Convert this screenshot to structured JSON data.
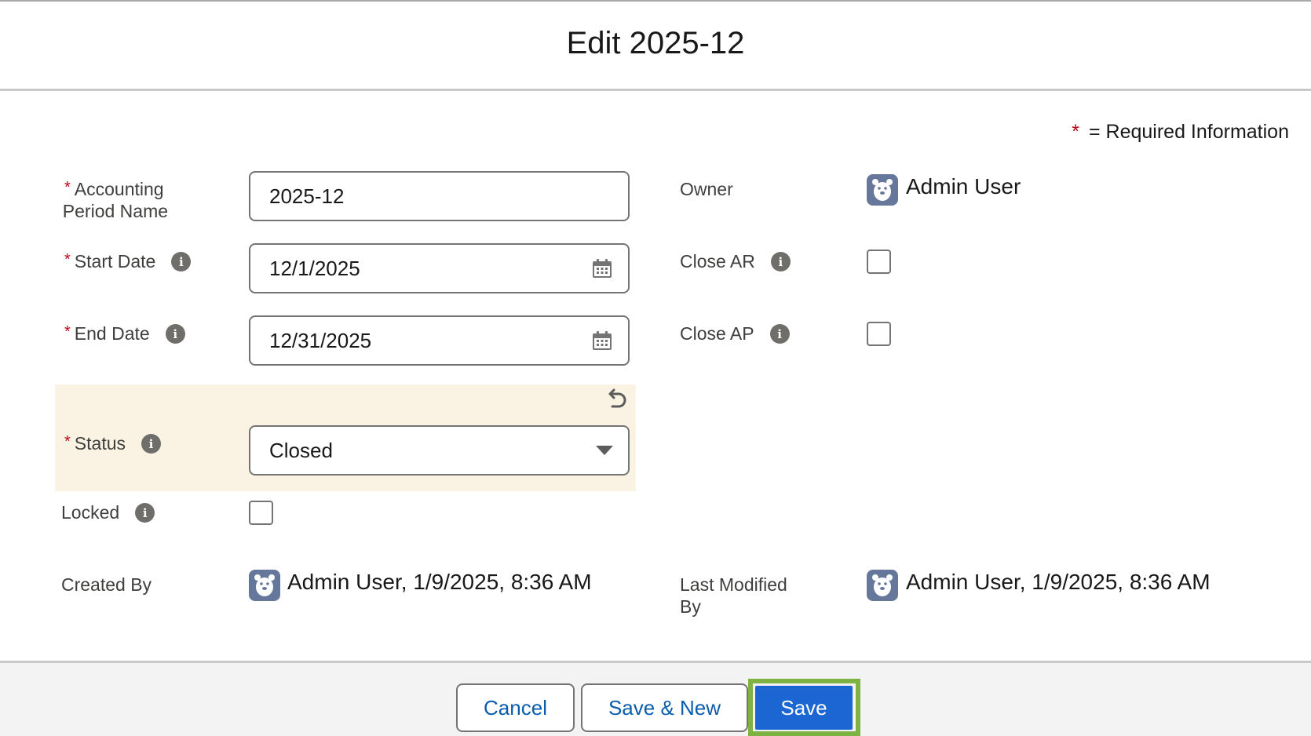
{
  "modal": {
    "title": "Edit 2025-12"
  },
  "required_info": {
    "star": "*",
    "text": "= Required Information"
  },
  "fields": {
    "accounting_period_name": {
      "label_line1": "Accounting",
      "label_line2": "Period Name",
      "value": "2025-12",
      "required": true
    },
    "start_date": {
      "label": "Start Date",
      "value": "12/1/2025",
      "required": true
    },
    "end_date": {
      "label": "End Date",
      "value": "12/31/2025",
      "required": true
    },
    "status": {
      "label": "Status",
      "value": "Closed",
      "required": true,
      "edited": true
    },
    "locked": {
      "label": "Locked",
      "checked": false
    },
    "created_by": {
      "label": "Created By",
      "value": "Admin User, 1/9/2025, 8:36 AM"
    },
    "owner": {
      "label": "Owner",
      "value": "Admin User"
    },
    "close_ar": {
      "label": "Close AR",
      "checked": false
    },
    "close_ap": {
      "label": "Close AP",
      "checked": false
    },
    "last_modified_by": {
      "label_line1": "Last Modified",
      "label_line2": "By",
      "value": "Admin User, 1/9/2025, 8:36 AM"
    }
  },
  "icons": {
    "info": "info-icon",
    "calendar": "calendar-icon",
    "dropdown": "chevron-down-icon",
    "undo": "undo-icon",
    "avatar": "user-avatar-icon",
    "info_glyph": "i"
  },
  "footer": {
    "cancel_label": "Cancel",
    "save_new_label": "Save & New",
    "save_label": "Save"
  },
  "colors": {
    "required_star": "#ba0517",
    "brand_button": "#1b66d2",
    "link_text": "#0b5cab",
    "edited_band": "#faf3e3",
    "highlight": "#7cb342",
    "avatar_bg": "#65779b"
  }
}
